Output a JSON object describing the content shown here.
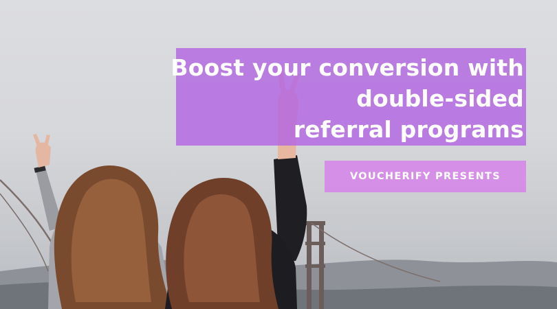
{
  "headline": {
    "lines": [
      "Boost your conversion with",
      "double-sided",
      "referral programs"
    ]
  },
  "tag": {
    "label": "VOUCHERIFY PRESENTS"
  },
  "colors": {
    "headline_box": "#b266e2",
    "tag_box": "#d685e8",
    "text": "#ffffff"
  }
}
